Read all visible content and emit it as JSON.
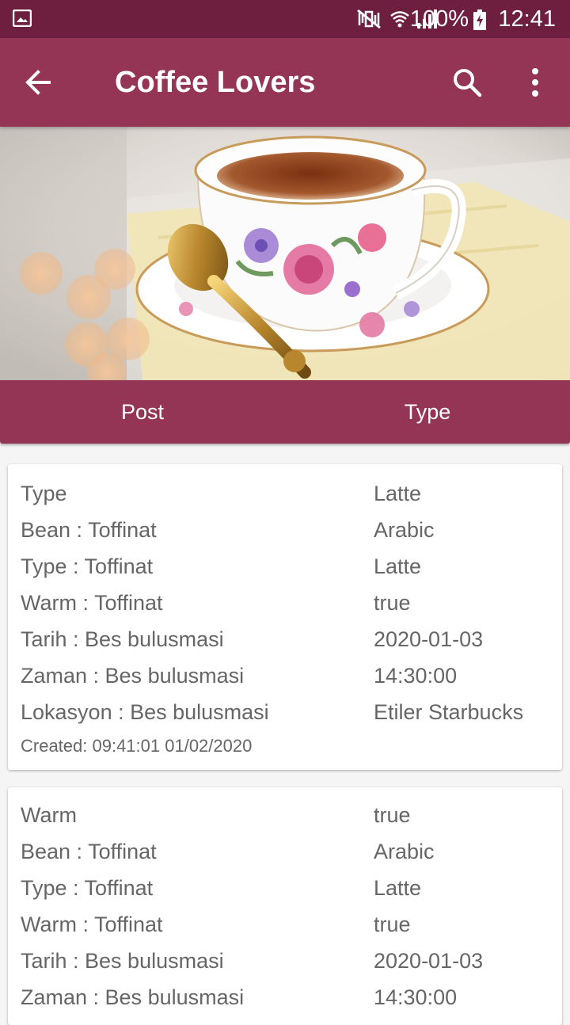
{
  "status_bar": {
    "battery": "100%",
    "time": "12:41",
    "icons": [
      "gallery-icon",
      "mute-icon",
      "wifi-icon",
      "signal-icon",
      "battery-charging-icon"
    ]
  },
  "app_bar": {
    "title": "Coffee Lovers",
    "icons": [
      "back-arrow-icon",
      "search-icon",
      "more-vert-icon"
    ]
  },
  "hero": {
    "description_icon": "teacup-image"
  },
  "tabs": [
    {
      "label": "Post"
    },
    {
      "label": "Type"
    }
  ],
  "cards": [
    {
      "rows": [
        {
          "key": "Type",
          "value": "Latte"
        },
        {
          "key": "Bean : Toffinat",
          "value": "Arabic"
        },
        {
          "key": "Type : Toffinat",
          "value": "Latte"
        },
        {
          "key": "Warm : Toffinat",
          "value": "true"
        },
        {
          "key": "Tarih : Bes bulusmasi",
          "value": "2020-01-03"
        },
        {
          "key": "Zaman : Bes bulusmasi",
          "value": "14:30:00"
        },
        {
          "key": "Lokasyon : Bes bulusmasi",
          "value": "Etiler Starbucks"
        }
      ],
      "created": "Created: 09:41:01 01/02/2020"
    },
    {
      "rows": [
        {
          "key": "Warm",
          "value": "true"
        },
        {
          "key": "Bean : Toffinat",
          "value": "Arabic"
        },
        {
          "key": "Type : Toffinat",
          "value": "Latte"
        },
        {
          "key": "Warm : Toffinat",
          "value": "true"
        },
        {
          "key": "Tarih : Bes bulusmasi",
          "value": "2020-01-03"
        },
        {
          "key": "Zaman : Bes bulusmasi",
          "value": "14:30:00"
        }
      ]
    }
  ],
  "colors": {
    "status_bar": "#6e1f40",
    "app_bar": "#953555",
    "text": "#666666"
  }
}
